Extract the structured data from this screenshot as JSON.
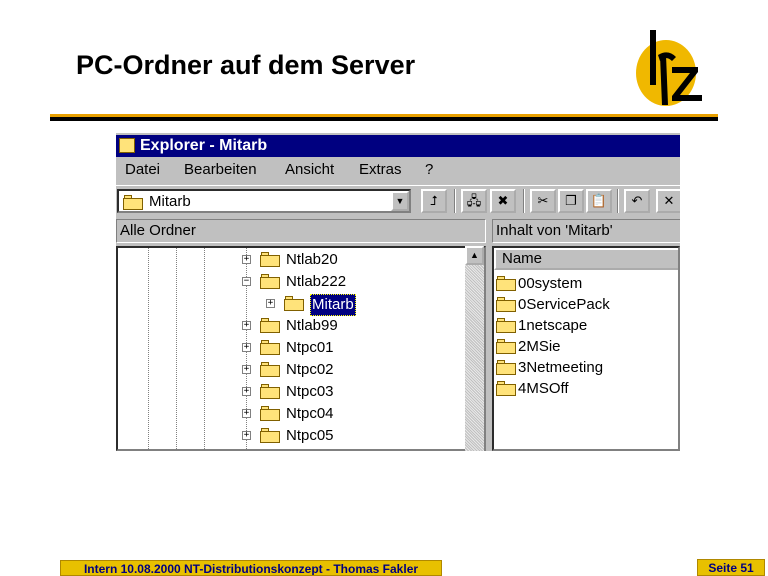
{
  "slide": {
    "title": "PC-Ordner auf dem Server",
    "footer_left": "Intern 10.08.2000 NT-Distributionskonzept - Thomas Fakler",
    "footer_right": "Seite 51",
    "logo_text": "lrz"
  },
  "window": {
    "title": "Explorer - Mitarb",
    "menu": [
      "Datei",
      "Bearbeiten",
      "Ansicht",
      "Extras",
      "?"
    ],
    "address_value": "Mitarb",
    "tree_header": "Alle Ordner",
    "content_header": "Inhalt von 'Mitarb'",
    "column_name": "Name",
    "tree_items": [
      {
        "label": "Ntlab20",
        "expander": "+"
      },
      {
        "label": "Ntlab222",
        "expander": "−"
      },
      {
        "label": "Mitarb",
        "expander": "+",
        "selected": true
      },
      {
        "label": "Ntlab99",
        "expander": "+"
      },
      {
        "label": "Ntpc01",
        "expander": "+"
      },
      {
        "label": "Ntpc02",
        "expander": "+"
      },
      {
        "label": "Ntpc03",
        "expander": "+"
      },
      {
        "label": "Ntpc04",
        "expander": "+"
      },
      {
        "label": "Ntpc05",
        "expander": "+"
      }
    ],
    "content_items": [
      "00system",
      "0ServicePack",
      "1netscape",
      "2MSie",
      "3Netmeeting",
      "4MSOff"
    ]
  },
  "colors": {
    "titlebar": "#000080",
    "accent_yellow": "#e8c000",
    "folder": "#ffe37a"
  }
}
